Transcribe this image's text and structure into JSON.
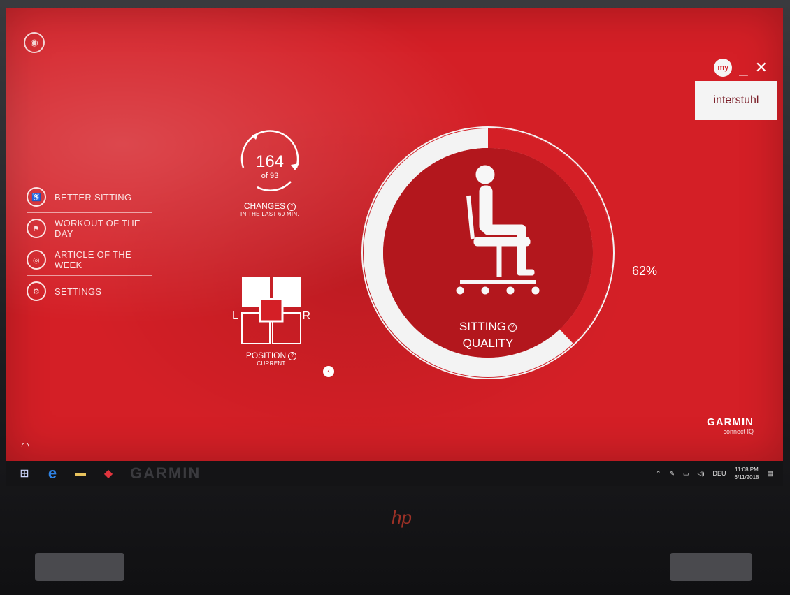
{
  "window": {
    "brand": "interstuhl",
    "my_badge": "my",
    "minimize": "_",
    "close": "✕"
  },
  "menu": {
    "items": [
      {
        "label": "BETTER SITTING",
        "icon": "posture-icon"
      },
      {
        "label": "WORKOUT OF THE DAY",
        "icon": "workout-icon"
      },
      {
        "label": "ARTICLE OF THE WEEK",
        "icon": "article-icon"
      },
      {
        "label": "SETTINGS",
        "icon": "gear-icon"
      }
    ]
  },
  "changes": {
    "value": "164",
    "of": "of 93",
    "label": "CHANGES",
    "sub": "IN THE LAST 60 MIN."
  },
  "position": {
    "left": "L",
    "right": "R",
    "label": "POSITION",
    "sub": "CURRENT"
  },
  "quality": {
    "percent_text": "62%",
    "percent": 62,
    "line1": "SITTING",
    "line2": "QUALITY"
  },
  "footer": {
    "brand": "GARMIN",
    "sub": "connect IQ"
  },
  "taskbar": {
    "watermark": "GARMIN",
    "lang": "DEU",
    "time": "11:08 PM",
    "date": "6/11/2018"
  },
  "colors": {
    "accent": "#d41f26",
    "dark": "#b3171d",
    "light": "#f3f3f3"
  }
}
